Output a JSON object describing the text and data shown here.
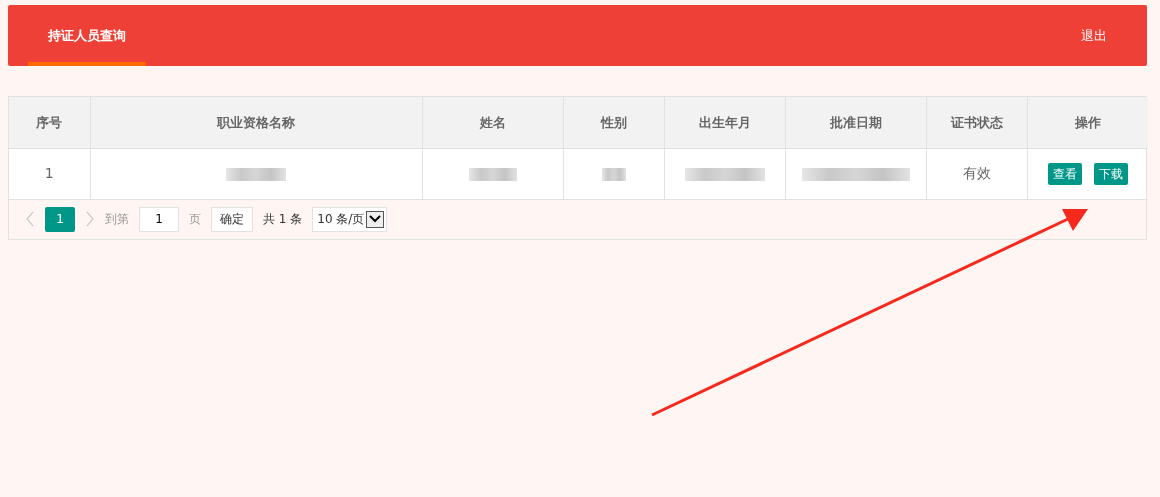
{
  "header": {
    "tabs": [
      {
        "label": "持证人员查询",
        "selected": true
      }
    ],
    "logout": "退出"
  },
  "table": {
    "columns": [
      "序号",
      "职业资格名称",
      "姓名",
      "性别",
      "出生年月",
      "批准日期",
      "证书状态",
      "操作"
    ],
    "rows": [
      {
        "cells": [
          {
            "kind": "text",
            "text": "1"
          },
          {
            "kind": "redacted"
          },
          {
            "kind": "redacted"
          },
          {
            "kind": "redacted"
          },
          {
            "kind": "redacted"
          },
          {
            "kind": "redacted"
          },
          {
            "kind": "text",
            "text": "有效"
          },
          {
            "kind": "actions",
            "buttons": [
              "查看",
              "下载"
            ]
          }
        ]
      }
    ]
  },
  "pager": {
    "prev_disabled": true,
    "pages": [
      {
        "label": "1",
        "selected": true
      }
    ],
    "next_disabled": true,
    "goto_label": "到第",
    "goto_value": "1",
    "page_unit": "页",
    "confirm": "确定",
    "total": "共 1 条",
    "page_size": "10 条/页"
  },
  "annotation": {
    "kind": "arrow"
  }
}
